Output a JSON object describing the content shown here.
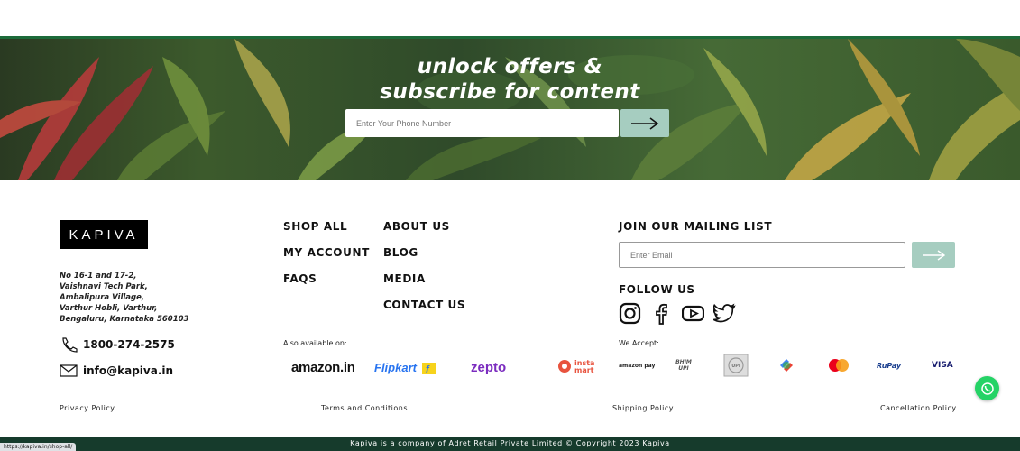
{
  "banner": {
    "title_line1": "unlock offers &",
    "title_line2": "subscribe for content",
    "phone_placeholder": "Enter Your Phone Number"
  },
  "brand": {
    "logo_text": "KAPIVA"
  },
  "address": [
    "No 16-1 and 17-2,",
    "Vaishnavi Tech Park,",
    "Ambalipura Village,",
    "Varthur Hobli, Varthur,",
    "Bengaluru, Karnataka 560103"
  ],
  "contact": {
    "phone": "1800-274-2575",
    "email": "info@kapiva.in"
  },
  "nav": {
    "col1": [
      "SHOP ALL",
      "MY ACCOUNT",
      "FAQS"
    ],
    "col2": [
      "ABOUT US",
      "BLOG",
      "MEDIA",
      "CONTACT US"
    ]
  },
  "also_available": {
    "label": "Also available on:",
    "stores": [
      "amazon.in",
      "Flipkart",
      "zepto",
      "insta mart"
    ]
  },
  "mailing": {
    "heading": "JOIN OUR MAILING LIST",
    "email_placeholder": "Enter Email"
  },
  "follow": {
    "heading": "FOLLOW US",
    "icons": [
      "instagram-icon",
      "facebook-icon",
      "youtube-icon",
      "twitter-icon"
    ]
  },
  "payments": {
    "label": "We Accept:",
    "methods": [
      "amazon pay",
      "BHIM UPI",
      "UPI",
      "Google Pay",
      "Mastercard",
      "RuPay",
      "VISA"
    ]
  },
  "policies": [
    "Privacy Policy",
    "Terms and Conditions",
    "Shipping Policy",
    "Cancellation Policy"
  ],
  "footer": {
    "copyright": "Kapiva is a company of Adret Retail Private Limited © Copyright 2023 Kapiva"
  },
  "status_url": "https://kapiva.in/shop-all/",
  "colors": {
    "accent_button": "#a6cdc0",
    "footer_bar": "#163b2c",
    "green_line": "#1d6b3a",
    "whatsapp": "#25d366"
  }
}
